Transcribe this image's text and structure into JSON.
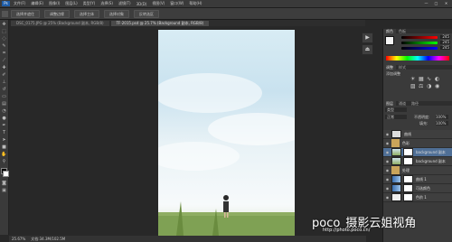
{
  "app": {
    "logo_text": "Ps"
  },
  "menubar": {
    "items": [
      "文件(F)",
      "编辑(E)",
      "图像(I)",
      "图层(L)",
      "类型(Y)",
      "选择(S)",
      "滤镜(T)",
      "3D(D)",
      "视图(V)",
      "窗口(W)",
      "帮助(H)"
    ]
  },
  "window_controls": {
    "minimize": "—",
    "maximize": "□",
    "close": "✕"
  },
  "options_bar": {
    "buttons": [
      "选择并遮住",
      "调整边缘",
      "选择主体",
      "选择对象",
      "反转选区"
    ]
  },
  "tabs": [
    {
      "label": "DSC_0175.JPG @ 25% (Background 副本, RGB/8)"
    },
    {
      "label": "TF-2015.psd @ 25.7% (Background 副本, RGB/8)"
    }
  ],
  "status": {
    "zoom": "25.67%",
    "doc": "文档:34.3M/102.5M"
  },
  "color_panel": {
    "tabs": [
      "颜色",
      "色板"
    ],
    "r": "245",
    "g": "245",
    "b": "245",
    "ramp": [
      "#ff0000",
      "#ffff00",
      "#00ff00",
      "#00ffff",
      "#0000ff",
      "#ff00ff",
      "#ff0000"
    ]
  },
  "adjust_panel": {
    "tabs": [
      "调整",
      "样式"
    ],
    "title": "添加调整"
  },
  "layers_panel": {
    "tabs": [
      "图层",
      "通道",
      "路径"
    ],
    "kind": "类型",
    "blend": "正常",
    "opacity_label": "不透明度:",
    "opacity": "100%",
    "fill_label": "填充:",
    "fill": "100%",
    "layers": [
      {
        "name": "曲线",
        "type": "adjust"
      },
      {
        "name": "色彩",
        "type": "group"
      },
      {
        "name": "background 副本",
        "type": "layer"
      },
      {
        "name": "background 副本",
        "type": "layer"
      },
      {
        "name": "处理",
        "type": "group"
      },
      {
        "name": "曲线 1",
        "type": "adjust"
      },
      {
        "name": "可选颜色",
        "type": "adjust"
      },
      {
        "name": "色阶 1",
        "type": "adjust"
      }
    ]
  },
  "watermark": {
    "brand": "poco",
    "cn": "摄影云姐视角",
    "url": "http://photo.poco.cn/"
  }
}
